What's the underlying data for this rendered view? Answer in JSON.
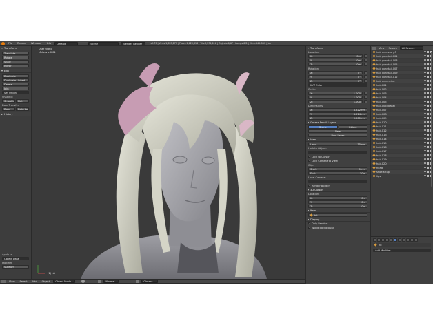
{
  "topbar": {
    "menus": [
      "File",
      "Render",
      "Window",
      "Help"
    ],
    "screen_layout": "Default",
    "scene": "Scene",
    "render_engine": "Blender Render",
    "info": "v2.79 | Verts:1,635,177 | Faces:1,623,616 | Tris:3,234,616 | Objects:0/67 | Lamps:0/0 | Mem:645.38M | ba"
  },
  "toolshelf": {
    "transform_header": "Transform",
    "transform_buttons": [
      "Translate",
      "Rotate",
      "Scale",
      "Mirror"
    ],
    "edit_header": "Edit",
    "edit_buttons": [
      "Duplicate",
      "Duplicate Linked",
      "Delete",
      "Join"
    ],
    "set_origin": "Set Origin",
    "shading_label": "Shading:",
    "shading_buttons": [
      "Smooth",
      "Flat"
    ],
    "data_transfer_label": "Data Transfer:",
    "data_transfer_buttons": [
      "Data",
      "Data Lay"
    ],
    "history_header": "History",
    "apply_to_label": "Apply to",
    "apply_to_value": "Object Data",
    "modifier_label": "Modifier",
    "modifier_value": "Subsurf"
  },
  "viewport": {
    "view_name": "User Ortho",
    "meters": "Meters x 0.01",
    "object_name": "(1) hit"
  },
  "bottombar": {
    "menus": [
      "View",
      "Select",
      "Add",
      "Object"
    ],
    "mode": "Object Mode",
    "pivot": "Normal",
    "snap": "Closest"
  },
  "properties": {
    "transform_header": "Transform",
    "location_label": "Location:",
    "location": [
      {
        "axis": "X:",
        "value": "0m"
      },
      {
        "axis": "Y:",
        "value": "0m"
      },
      {
        "axis": "Z:",
        "value": "0m"
      }
    ],
    "rotation_label": "Rotation:",
    "rotation": [
      {
        "axis": "X:",
        "value": "0°"
      },
      {
        "axis": "Y:",
        "value": "0°"
      },
      {
        "axis": "Z:",
        "value": "0°"
      }
    ],
    "rotation_mode": "XYZ Euler",
    "scale_label": "Scale:",
    "scale": [
      {
        "axis": "X:",
        "value": "1.000"
      },
      {
        "axis": "Y:",
        "value": "1.000"
      },
      {
        "axis": "Z:",
        "value": "1.000"
      }
    ],
    "dimensions_label": "Dimensions:",
    "dimensions": [
      {
        "axis": "X:",
        "value": "4.522mm"
      },
      {
        "axis": "Y:",
        "value": "4.514mm"
      },
      {
        "axis": "Z:",
        "value": "0.261mm"
      }
    ],
    "grease_header": "Grease Pencil Layers",
    "grease_tabs": [
      "Scene",
      "Object"
    ],
    "grease_new": "New",
    "grease_new_layer": "New Layer",
    "view_header": "View",
    "lens_label": "Lens:",
    "lens_value": "35mm",
    "lock_object": "Lock to Object:",
    "lock_cursor": "Lock to Cursor",
    "lock_camera": "Lock Camera to View",
    "clip_label": "Clip:",
    "clip_start_label": "Start:",
    "clip_start_value": "1mm",
    "clip_end_label": "End:",
    "clip_end_value": "10m",
    "local_camera": "Local Camera:",
    "render_border": "Render Border",
    "cursor_header": "3D Cursor",
    "cursor_location_label": "Location:",
    "cursor_location": [
      {
        "axis": "X:",
        "value": "0m"
      },
      {
        "axis": "Y:",
        "value": "0m"
      },
      {
        "axis": "Z:",
        "value": "0m"
      }
    ],
    "item_header": "Item",
    "item_name": "hit",
    "display_header": "Display",
    "only_render": "Only Render",
    "world_background": "World Background"
  },
  "outliner": {
    "view_label": "View",
    "search_label": "Search",
    "filter": "All Scenes",
    "items": [
      "hair accessory.R",
      "hair ponytail.001",
      "hair ponytail.003",
      "hair ponytail.005",
      "hair ponytail.007",
      "hair ponytail.009",
      "hair ponytail.012",
      "hair accent.fac",
      "hair.001",
      "hair.002",
      "hair.003",
      "hair.004",
      "hair.005",
      "hair.006 (base)",
      "hair.007",
      "hair.008",
      "hair.009",
      "hair.010",
      "hair.011",
      "hair.012",
      "hair.013",
      "hair.014",
      "hair.015",
      "hair.016",
      "hair.017",
      "hair.018",
      "hair.019",
      "hair.020",
      "head",
      "shoe.strap",
      "lips"
    ]
  },
  "modifiers": {
    "add_modifier": "Add Modifier"
  },
  "colors": {
    "ui_background": "#393939",
    "accent_blue": "#5680c2",
    "object_orange": "#d89c3e",
    "model_gray": "#a8a8ad",
    "flower_pink": "#c79cb3"
  }
}
